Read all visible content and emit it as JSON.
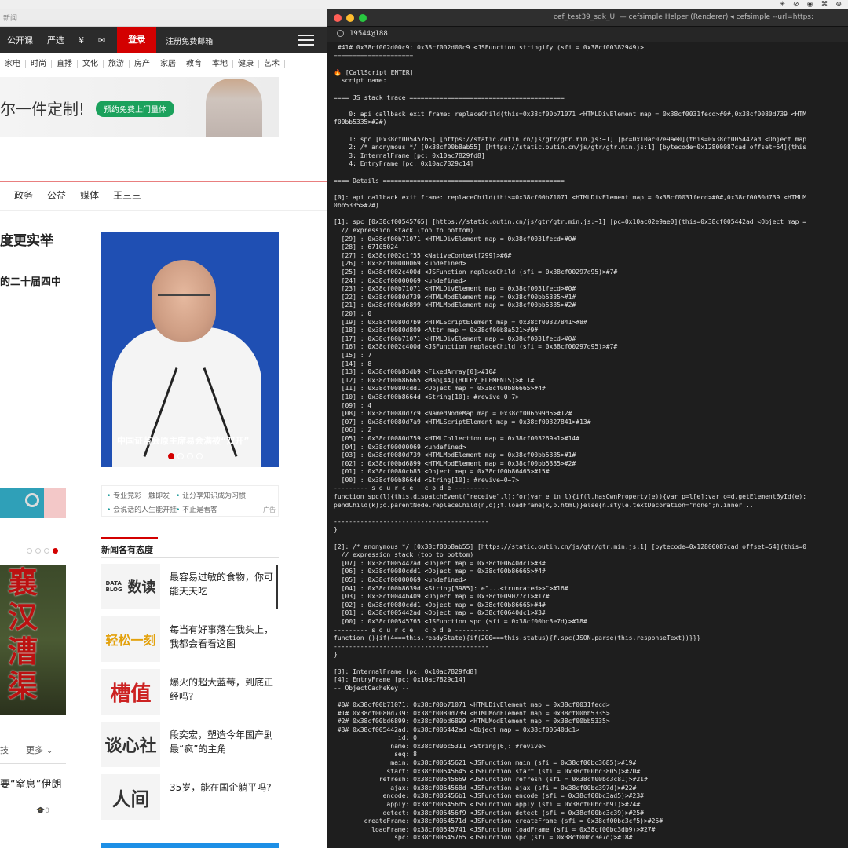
{
  "menubar": {
    "icons": [
      "✳",
      "⊘",
      "◉",
      "⌘",
      "⊕"
    ]
  },
  "browser": {
    "window_title": "新闻",
    "topnav": {
      "items": [
        "公开课",
        "严选",
        "¥",
        "✉"
      ],
      "login": "登录",
      "register": "注册免费邮箱"
    },
    "catnav": [
      "家电",
      "时尚",
      "直播",
      "文化",
      "旅游",
      "房产",
      "家居",
      "教育",
      "本地",
      "健康",
      "艺术"
    ],
    "ad": {
      "text": "尔一件定制!",
      "button": "预约免费上门量体"
    },
    "subnav": [
      "政务",
      "公益",
      "媒体",
      "王三三"
    ],
    "headline1": "度更实举",
    "headline2": "的二十届四中",
    "photo_caption": "中国证监会原主席易会满被“双开”",
    "links": {
      "l1": "专业竞彩一触即发",
      "l2": "让分享知识成为习惯",
      "l3": "会说话的人生能开挂",
      "l4": "不止是看客",
      "ad_tag": "广告"
    },
    "book_title": [
      "襄",
      "汉",
      "漕",
      "渠"
    ],
    "tab_left": "技",
    "more": "更多",
    "title_left": "要“窒息”伊朗",
    "count_left": "0",
    "section_title": "新闻各有态度",
    "news": [
      {
        "logo": "数读",
        "logo_small": "DATA BLOG",
        "text": "最容易过敏的食物，你可能天天吃"
      },
      {
        "logo": "轻松一刻",
        "text": "每当有好事落在我头上，我都会看看这图"
      },
      {
        "logo": "槽值",
        "text": "爆火的超大蓝莓，到底正经吗?"
      },
      {
        "logo": "谈心社",
        "text": "段奕宏，塑造今年国产剧最“疯”的主角"
      },
      {
        "logo": "人间",
        "text": "35岁，能在国企躺平吗?"
      }
    ]
  },
  "terminal": {
    "title": "cef_test39_sdk_UI — cefsimple Helper (Renderer) ◂ cefsimple --url=https:",
    "search_query": "19544@188",
    "lines": [
      " #41# 0x38cf002d00c9: 0x38cf002d00c9 <JSFunction stringify (sfi = 0x38cf00382949)>",
      "=====================",
      "",
      "🔥 [CallScript ENTER]",
      "  script name:",
      "",
      "==== JS stack trace =========================================",
      "",
      "    0: api callback exit frame: replaceChild(this=0x38cf00b71071 <HTMLDivElement map = 0x38cf0031fecd>#0#,0x38cf0080d739 <HTM",
      "f00bb5335>#2#)",
      "",
      "    1: spc [0x38cf00545765] [https://static.outin.cn/js/gtr/gtr.min.js:~1] [pc=0x10ac02e9ae0](this=0x38cf005442ad <Object map",
      "    2: /* anonymous */ [0x38cf00b8ab55] [https://static.outin.cn/js/gtr/gtr.min.js:1] [bytecode=0x12800087cad offset=54](this",
      "    3: InternalFrame [pc: 0x10ac7829fd8]",
      "    4: EntryFrame [pc: 0x10ac7829c14]",
      "",
      "==== Details ================================================",
      "",
      "[0]: api callback exit frame: replaceChild(this=0x38cf00b71071 <HTMLDivElement map = 0x38cf0031fecd>#0#,0x38cf0080d739 <HTMLM",
      "0bb5335>#2#)",
      "",
      "[1]: spc [0x38cf00545765] [https://static.outin.cn/js/gtr/gtr.min.js:~1] [pc=0x10ac02e9ae0](this=0x38cf005442ad <Object map =",
      "  // expression stack (top to bottom)",
      "  [29] : 0x38cf00b71071 <HTMLDivElement map = 0x38cf0031fecd>#0#",
      "  [28] : 67105024",
      "  [27] : 0x38cf002c1f55 <NativeContext[299]>#6#",
      "  [26] : 0x38cf00000069 <undefined>",
      "  [25] : 0x38cf002c400d <JSFunction replaceChild (sfi = 0x38cf00297d95)>#7#",
      "  [24] : 0x38cf00000069 <undefined>",
      "  [23] : 0x38cf00b71071 <HTMLDivElement map = 0x38cf0031fecd>#0#",
      "  [22] : 0x38cf0080d739 <HTMLModElement map = 0x38cf00bb5335>#1#",
      "  [21] : 0x38cf00bd6899 <HTMLModElement map = 0x38cf00bb5335>#2#",
      "  [20] : 0",
      "  [19] : 0x38cf0080d7b9 <HTMLScriptElement map = 0x38cf00327841>#8#",
      "  [18] : 0x38cf0080d809 <Attr map = 0x38cf00b8a521>#9#",
      "  [17] : 0x38cf00b71071 <HTMLDivElement map = 0x38cf0031fecd>#0#",
      "  [16] : 0x38cf002c400d <JSFunction replaceChild (sfi = 0x38cf00297d95)>#7#",
      "  [15] : 7",
      "  [14] : 8",
      "  [13] : 0x38cf00b83db9 <FixedArray[0]>#10#",
      "  [12] : 0x38cf00b86665 <Map[44](HOLEY_ELEMENTS)>#11#",
      "  [11] : 0x38cf0080cdd1 <Object map = 0x38cf00b86665>#4#",
      "  [10] : 0x38cf00b8664d <String[10]: #revive~0~7>",
      "  [09] : 4",
      "  [08] : 0x38cf0080d7c9 <NamedNodeMap map = 0x38cf006b99d5>#12#",
      "  [07] : 0x38cf0080d7a9 <HTMLScriptElement map = 0x38cf00327841>#13#",
      "  [06] : 2",
      "  [05] : 0x38cf0080d759 <HTMLCollection map = 0x38cf003269a1>#14#",
      "  [04] : 0x38cf00000069 <undefined>",
      "  [03] : 0x38cf0080d739 <HTMLModElement map = 0x38cf00bb5335>#1#",
      "  [02] : 0x38cf00bd6899 <HTMLModElement map = 0x38cf00bb5335>#2#",
      "  [01] : 0x38cf0080cb85 <Object map = 0x38cf00b86465>#15#",
      "  [00] : 0x38cf00b8664d <String[10]: #revive~0~7>",
      "--------- s o u r c e   c o d e ---------",
      "function spc(l){this.dispatchEvent(\"receive\",l);for(var e in l){if(l.hasOwnProperty(e)){var p=l[e];var o=d.getElementById(e);",
      "pendChild(k);o.parentNode.replaceChild(n,o);f.loadFrame(k,p.html)}else{n.style.textDecoration=\"none\";n.inner...",
      "",
      "-----------------------------------------",
      "}",
      "",
      "[2]: /* anonymous */ [0x38cf00b8ab55] [https://static.outin.cn/js/gtr/gtr.min.js:1] [bytecode=0x12800087cad offset=54](this=0",
      "  // expression stack (top to bottom)",
      "  [07] : 0x38cf005442ad <Object map = 0x38cf00640dc1>#3#",
      "  [06] : 0x38cf0080cdd1 <Object map = 0x38cf00b86665>#4#",
      "  [05] : 0x38cf00000069 <undefined>",
      "  [04] : 0x38cf00b8639d <String[3985]: e\"...<truncated>>\">#16#",
      "  [03] : 0x38cf0044b409 <Object map = 0x38cf009027c1>#17#",
      "  [02] : 0x38cf0080cdd1 <Object map = 0x38cf00b86665>#4#",
      "  [01] : 0x38cf005442ad <Object map = 0x38cf00640dc1>#3#",
      "  [00] : 0x38cf00545765 <JSFunction spc (sfi = 0x38cf00bc3e7d)>#18#",
      "--------- s o u r c e   c o d e ---------",
      "function (){if(4===this.readyState){if(200===this.status){f.spc(JSON.parse(this.responseText))}}}",
      "-----------------------------------------",
      "}",
      "",
      "[3]: InternalFrame [pc: 0x10ac7829fd8]",
      "[4]: EntryFrame [pc: 0x10ac7829c14]",
      "-- ObjectCacheKey --",
      "",
      " #0# 0x38cf00b71071: 0x38cf00b71071 <HTMLDivElement map = 0x38cf0031fecd>",
      " #1# 0x38cf0080d739: 0x38cf0080d739 <HTMLModElement map = 0x38cf00bb5335>",
      " #2# 0x38cf00bd6899: 0x38cf00bd6899 <HTMLModElement map = 0x38cf00bb5335>",
      " #3# 0x38cf005442ad: 0x38cf005442ad <Object map = 0x38cf00640dc1>",
      "                 id: 0",
      "               name: 0x38cf00bc5311 <String[6]: #revive>",
      "                seq: 8",
      "               main: 0x38cf00545621 <JSFunction main (sfi = 0x38cf00bc3685)>#19#",
      "              start: 0x38cf00545645 <JSFunction start (sfi = 0x38cf00bc3805)>#20#",
      "            refresh: 0x38cf00545669 <JSFunction refresh (sfi = 0x38cf00bc3c81)>#21#",
      "               ajax: 0x38cf0054568d <JSFunction ajax (sfi = 0x38cf00bc397d)>#22#",
      "             encode: 0x38cf005456b1 <JSFunction encode (sfi = 0x38cf00bc3ad5)>#23#",
      "              apply: 0x38cf005456d5 <JSFunction apply (sfi = 0x38cf00bc3b91)>#24#",
      "             detect: 0x38cf005456f9 <JSFunction detect (sfi = 0x38cf00bc3c39)>#25#",
      "        createFrame: 0x38cf0054571d <JSFunction createFrame (sfi = 0x38cf00bc3cf5)>#26#",
      "          loadFrame: 0x38cf00545741 <JSFunction loadFrame (sfi = 0x38cf00bc3db9)>#27#",
      "                spc: 0x38cf00545765 <JSFunction spc (sfi = 0x38cf00bc3e7d)>#18#"
    ]
  }
}
